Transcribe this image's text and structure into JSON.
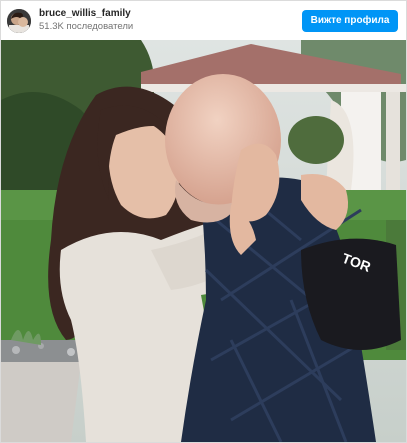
{
  "post": {
    "username": "bruce_willis_family",
    "followers": "51.3K последователи",
    "follow_label": "Вижте профила"
  },
  "photo": {
    "cap_text": "TOR"
  },
  "colors": {
    "follow_button": "#0095f6",
    "username_text": "#262626",
    "secondary_text": "#737373",
    "card_border": "#dbdbdb"
  },
  "icons": [
    "avatar-image"
  ]
}
